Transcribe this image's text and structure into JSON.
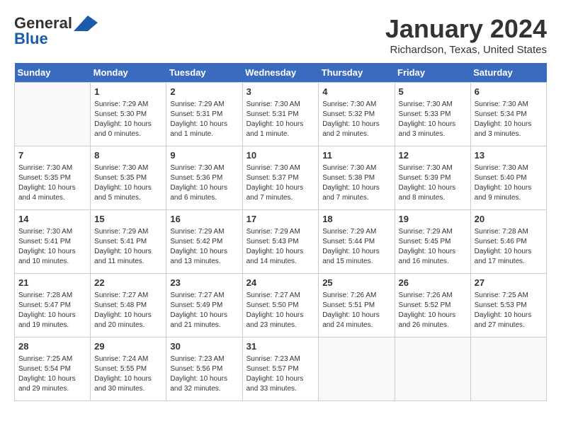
{
  "header": {
    "logo_line1": "General",
    "logo_line2": "Blue",
    "month": "January 2024",
    "location": "Richardson, Texas, United States"
  },
  "weekdays": [
    "Sunday",
    "Monday",
    "Tuesday",
    "Wednesday",
    "Thursday",
    "Friday",
    "Saturday"
  ],
  "weeks": [
    [
      {
        "num": "",
        "info": ""
      },
      {
        "num": "1",
        "info": "Sunrise: 7:29 AM\nSunset: 5:30 PM\nDaylight: 10 hours\nand 0 minutes."
      },
      {
        "num": "2",
        "info": "Sunrise: 7:29 AM\nSunset: 5:31 PM\nDaylight: 10 hours\nand 1 minute."
      },
      {
        "num": "3",
        "info": "Sunrise: 7:30 AM\nSunset: 5:31 PM\nDaylight: 10 hours\nand 1 minute."
      },
      {
        "num": "4",
        "info": "Sunrise: 7:30 AM\nSunset: 5:32 PM\nDaylight: 10 hours\nand 2 minutes."
      },
      {
        "num": "5",
        "info": "Sunrise: 7:30 AM\nSunset: 5:33 PM\nDaylight: 10 hours\nand 3 minutes."
      },
      {
        "num": "6",
        "info": "Sunrise: 7:30 AM\nSunset: 5:34 PM\nDaylight: 10 hours\nand 3 minutes."
      }
    ],
    [
      {
        "num": "7",
        "info": "Sunrise: 7:30 AM\nSunset: 5:35 PM\nDaylight: 10 hours\nand 4 minutes."
      },
      {
        "num": "8",
        "info": "Sunrise: 7:30 AM\nSunset: 5:35 PM\nDaylight: 10 hours\nand 5 minutes."
      },
      {
        "num": "9",
        "info": "Sunrise: 7:30 AM\nSunset: 5:36 PM\nDaylight: 10 hours\nand 6 minutes."
      },
      {
        "num": "10",
        "info": "Sunrise: 7:30 AM\nSunset: 5:37 PM\nDaylight: 10 hours\nand 7 minutes."
      },
      {
        "num": "11",
        "info": "Sunrise: 7:30 AM\nSunset: 5:38 PM\nDaylight: 10 hours\nand 7 minutes."
      },
      {
        "num": "12",
        "info": "Sunrise: 7:30 AM\nSunset: 5:39 PM\nDaylight: 10 hours\nand 8 minutes."
      },
      {
        "num": "13",
        "info": "Sunrise: 7:30 AM\nSunset: 5:40 PM\nDaylight: 10 hours\nand 9 minutes."
      }
    ],
    [
      {
        "num": "14",
        "info": "Sunrise: 7:30 AM\nSunset: 5:41 PM\nDaylight: 10 hours\nand 10 minutes."
      },
      {
        "num": "15",
        "info": "Sunrise: 7:29 AM\nSunset: 5:41 PM\nDaylight: 10 hours\nand 11 minutes."
      },
      {
        "num": "16",
        "info": "Sunrise: 7:29 AM\nSunset: 5:42 PM\nDaylight: 10 hours\nand 13 minutes."
      },
      {
        "num": "17",
        "info": "Sunrise: 7:29 AM\nSunset: 5:43 PM\nDaylight: 10 hours\nand 14 minutes."
      },
      {
        "num": "18",
        "info": "Sunrise: 7:29 AM\nSunset: 5:44 PM\nDaylight: 10 hours\nand 15 minutes."
      },
      {
        "num": "19",
        "info": "Sunrise: 7:29 AM\nSunset: 5:45 PM\nDaylight: 10 hours\nand 16 minutes."
      },
      {
        "num": "20",
        "info": "Sunrise: 7:28 AM\nSunset: 5:46 PM\nDaylight: 10 hours\nand 17 minutes."
      }
    ],
    [
      {
        "num": "21",
        "info": "Sunrise: 7:28 AM\nSunset: 5:47 PM\nDaylight: 10 hours\nand 19 minutes."
      },
      {
        "num": "22",
        "info": "Sunrise: 7:27 AM\nSunset: 5:48 PM\nDaylight: 10 hours\nand 20 minutes."
      },
      {
        "num": "23",
        "info": "Sunrise: 7:27 AM\nSunset: 5:49 PM\nDaylight: 10 hours\nand 21 minutes."
      },
      {
        "num": "24",
        "info": "Sunrise: 7:27 AM\nSunset: 5:50 PM\nDaylight: 10 hours\nand 23 minutes."
      },
      {
        "num": "25",
        "info": "Sunrise: 7:26 AM\nSunset: 5:51 PM\nDaylight: 10 hours\nand 24 minutes."
      },
      {
        "num": "26",
        "info": "Sunrise: 7:26 AM\nSunset: 5:52 PM\nDaylight: 10 hours\nand 26 minutes."
      },
      {
        "num": "27",
        "info": "Sunrise: 7:25 AM\nSunset: 5:53 PM\nDaylight: 10 hours\nand 27 minutes."
      }
    ],
    [
      {
        "num": "28",
        "info": "Sunrise: 7:25 AM\nSunset: 5:54 PM\nDaylight: 10 hours\nand 29 minutes."
      },
      {
        "num": "29",
        "info": "Sunrise: 7:24 AM\nSunset: 5:55 PM\nDaylight: 10 hours\nand 30 minutes."
      },
      {
        "num": "30",
        "info": "Sunrise: 7:23 AM\nSunset: 5:56 PM\nDaylight: 10 hours\nand 32 minutes."
      },
      {
        "num": "31",
        "info": "Sunrise: 7:23 AM\nSunset: 5:57 PM\nDaylight: 10 hours\nand 33 minutes."
      },
      {
        "num": "",
        "info": ""
      },
      {
        "num": "",
        "info": ""
      },
      {
        "num": "",
        "info": ""
      }
    ]
  ]
}
